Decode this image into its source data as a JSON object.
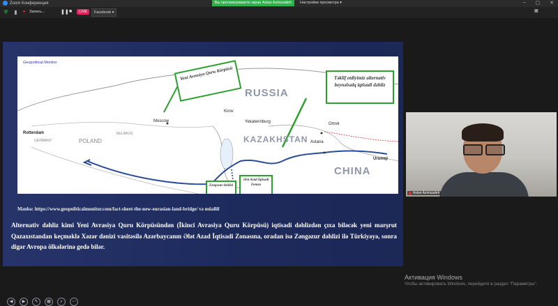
{
  "titlebar": {
    "app_title": "Zoom Конференция",
    "minimize": "–",
    "maximize": "▢",
    "close": "✕"
  },
  "share_banner": "Вы просматриваете экран Aslan Azimzadeh",
  "view_options": "Настройки просмотра ▾",
  "toolbar": {
    "record_label": "Запись...",
    "live_label": "LIVE",
    "facebook_label": "Facebook ▾"
  },
  "slide": {
    "watermark": "Geopolitical Monitor",
    "map_labels": {
      "russia": "RUSSIA",
      "kazakhstan": "KAZAKHSTAN",
      "china": "CHINA",
      "moscow": "Moscow",
      "kirov": "Kirov",
      "yekaterinburg": "Yekaterinburg",
      "omsk": "Omsk",
      "astana": "Astana",
      "urumqi": "Urumqi",
      "rotterdam": "Rotterdam",
      "germany": "GERMANY",
      "poland": "POLAND",
      "belarus": "BELARUS"
    },
    "callouts": {
      "bridge": "Yeni Avrasiya Quru Körpüsü",
      "proposed": "Təklif etdiyimiz alternativ beynəlxalq iqtisadi dəhliz",
      "zangezur": "Zəngəzur dəhlizi",
      "alat": "Ələt Azad İqtisadi Zonası"
    },
    "source": "Mənbə: https://www.geopoliticalmonitor.com/fact-sheet-the-new-eurasian-land-bridge/ və müəllif",
    "paragraph": "Alternativ dəhliz kimi Yeni Avrasiya Quru Körpüsündən (İkinci Avrasiya Quru Körpüsü) iqtisadi dəhlizdən çıxa biləcək yeni marşrut Qazaxıstandan keçməklə Xəzər dənizi vasitəsilə Azərbaycanın Ələt Azad İqtisadi Zonasına, oradan isə Zəngəzur dəhlizi ilə Türkiyəyə, sonra digər Avropa ölkələrinə gedə bilər."
  },
  "video": {
    "participant_name": "Aslan Azimzadeh"
  },
  "activation": {
    "title": "Активация Windows",
    "subtitle": "Чтобы активировать Windows, перейдите в раздел \"Параметры\"."
  },
  "colors": {
    "accent_green": "#2fb24c",
    "live_red": "#e0245e",
    "slide_bg": "#26346a"
  }
}
